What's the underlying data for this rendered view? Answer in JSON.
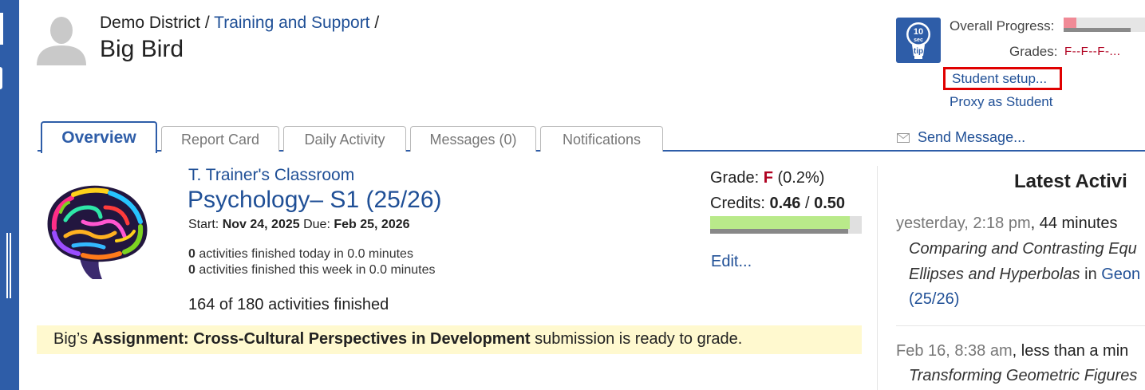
{
  "header": {
    "district": "Demo District",
    "crumb_sep": "/",
    "training_link": "Training and Support",
    "student_name": "Big Bird"
  },
  "tip": {
    "number": "10",
    "line1": "sec",
    "line2": "tip"
  },
  "status": {
    "overall_label": "Overall Progress:",
    "overall_progress_fraction": 0.16,
    "grades_label": "Grades:",
    "grades_value": "F--F--F-..."
  },
  "links": {
    "student_setup": "Student setup...",
    "proxy": "Proxy as Student",
    "send_message": "Send Message..."
  },
  "tabs": [
    {
      "label": "Overview",
      "active": true
    },
    {
      "label": "Report Card",
      "active": false
    },
    {
      "label": "Daily Activity",
      "active": false
    },
    {
      "label": "Messages (0)",
      "active": false
    },
    {
      "label": "Notifications",
      "active": false
    }
  ],
  "course": {
    "classroom": "T. Trainer's Classroom",
    "title": "Psychology– S1 (25/26)",
    "start_label": "Start:",
    "start_date": "Nov 24, 2025",
    "due_label": "Due:",
    "due_date": "Feb 25, 2026",
    "today_count": "0",
    "today_text": " activities finished today in 0.0 minutes",
    "week_count": "0",
    "week_text": " activities finished this week in 0.0 minutes",
    "finished": "164 of 180 activities finished",
    "grade_label": "Grade:",
    "grade_letter": "F",
    "grade_pct": "(0.2%)",
    "credits_label": "Credits:",
    "credits_earned": "0.46",
    "credits_sep": "/",
    "credits_total": "0.50",
    "credits_fraction": 0.92,
    "edit": "Edit..."
  },
  "notice": {
    "prefix": "Big’s ",
    "assignment": "Assignment: Cross-Cultural Perspectives in Development",
    "suffix": " submission is ready to grade."
  },
  "latest": {
    "title": "Latest Activi",
    "items": [
      {
        "time": "yesterday, 2:18 pm",
        "duration": ", 44 minutes",
        "line1": "Comparing and Contrasting Equ",
        "line2": "Ellipses and Hyperbolas",
        "line2_in": " in ",
        "line2_link": "Geon",
        "line3": "(25/26)"
      },
      {
        "time": "Feb 16, 8:38 am",
        "duration": ", less than a min",
        "line1": "Transforming Geometric Figures"
      }
    ]
  },
  "colors": {
    "brand_blue": "#2e5da8",
    "link_blue": "#1f4f96",
    "grade_red": "#b00020",
    "progress_pink": "#f08a96",
    "credit_green": "#b9ea8a",
    "notice_yellow": "#fff9cf",
    "highlight_red": "#e00000"
  },
  "icons": {
    "avatar": "person-silhouette-icon",
    "tip": "lightbulb-tip-icon",
    "send": "envelope-icon",
    "course": "colorful-brain-image"
  }
}
